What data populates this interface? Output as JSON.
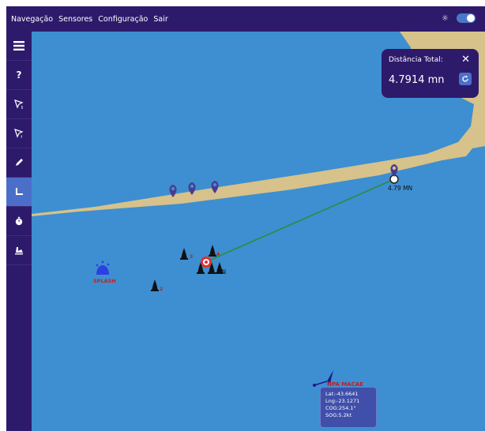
{
  "menu": {
    "items": [
      "Navegação",
      "Sensores",
      "Configuração",
      "Sair"
    ]
  },
  "theme": {
    "sun_icon": "sun-icon",
    "toggle_state": "on"
  },
  "sidebar": {
    "items": [
      {
        "name": "menu",
        "label": "",
        "icon": "hamburger-icon"
      },
      {
        "name": "help",
        "label": "?",
        "icon": "question-icon"
      },
      {
        "name": "select-1",
        "label": "",
        "icon": "pointer-icon"
      },
      {
        "name": "select-2",
        "label": "",
        "icon": "pointer-alt-icon"
      },
      {
        "name": "draw",
        "label": "",
        "icon": "pencil-icon"
      },
      {
        "name": "measure",
        "label": "",
        "icon": "ruler-icon",
        "active": true
      },
      {
        "name": "timer",
        "label": "",
        "icon": "stopwatch-icon"
      },
      {
        "name": "anchor",
        "label": "",
        "icon": "anchor-icon"
      }
    ]
  },
  "distance_panel": {
    "title": "Distância Total:",
    "value": "4.7914 mn"
  },
  "map": {
    "end_label": "4.79 MN",
    "mid_label": "MN",
    "splash_label": "SPLASH",
    "buoy_labels": [
      "3",
      "4",
      "2"
    ],
    "vessel_name": "NPA MACAE",
    "vessel_info": [
      "Lat:-43.6641",
      "Lng:-23.1271",
      "COG:254.1°",
      "SOG:5.2kt"
    ]
  },
  "colors": {
    "navy": "#2e1a6b",
    "sea": "#3d8fd1",
    "land": "#d6c28a",
    "accent": "#4b6fc9",
    "route": "#2e8b3e",
    "marker": "#4b3a8f"
  }
}
